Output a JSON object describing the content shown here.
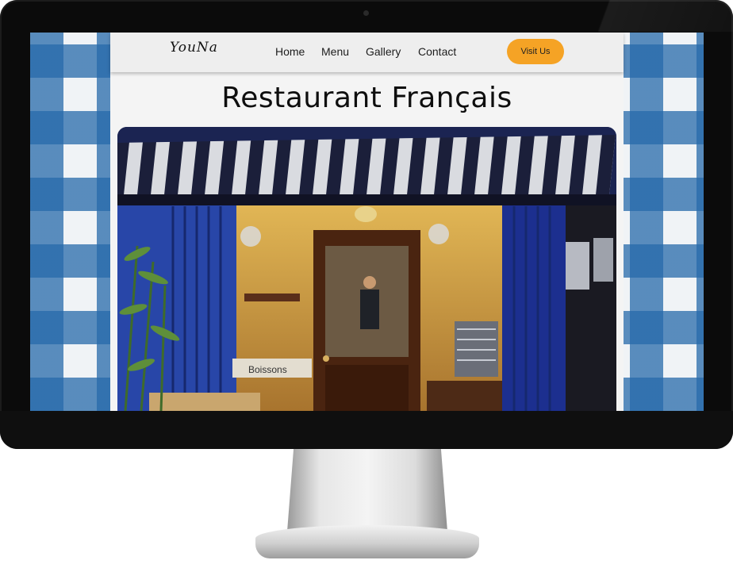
{
  "brand": {
    "logo_text": "YouNa"
  },
  "nav": {
    "links": [
      {
        "label": "Home"
      },
      {
        "label": "Menu"
      },
      {
        "label": "Gallery"
      },
      {
        "label": "Contact"
      }
    ],
    "cta_label": "Visit Us"
  },
  "hero": {
    "title": "Restaurant Français",
    "photo_sign_text": "Boissons"
  },
  "colors": {
    "accent": "#f5a325",
    "gingham_blue": "#2669aa",
    "nav_background": "#eeeeee"
  }
}
